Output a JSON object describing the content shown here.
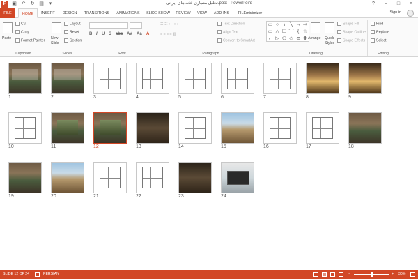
{
  "window": {
    "title": "تحلیل معماری خانه های ایرانی.pptx - PowerPoint",
    "app_logo": "P",
    "controls": [
      "?",
      "–",
      "□",
      "✕"
    ],
    "sign_in": "Sign in"
  },
  "quick_access": {
    "save_icon": "save-icon",
    "undo_icon": "undo-icon",
    "redo_icon": "redo-icon",
    "present_icon": "start-from-beginning-icon"
  },
  "tabs": [
    {
      "label": "FILE"
    },
    {
      "label": "HOME"
    },
    {
      "label": "INSERT"
    },
    {
      "label": "DESIGN"
    },
    {
      "label": "TRANSITIONS"
    },
    {
      "label": "ANIMATIONS"
    },
    {
      "label": "SLIDE SHOW"
    },
    {
      "label": "REVIEW"
    },
    {
      "label": "VIEW"
    },
    {
      "label": "ADD-INS"
    },
    {
      "label": "FILEminimizer"
    }
  ],
  "ribbon": {
    "clipboard": {
      "label": "Clipboard",
      "paste": "Paste",
      "cut": "Cut",
      "copy": "Copy",
      "format_painter": "Format Painter"
    },
    "slides": {
      "label": "Slides",
      "new_slide": "New",
      "new_slide_2": "Slide",
      "layout": "Layout",
      "reset": "Reset",
      "section": "Section"
    },
    "font": {
      "label": "Font",
      "bold": "B",
      "italic": "I",
      "underline": "U",
      "shadow": "S",
      "strike": "abc",
      "char_spacing": "AV",
      "case": "Aa",
      "font_color": "A"
    },
    "paragraph": {
      "label": "Paragraph",
      "text_direction": "Text Direction",
      "align_text": "Align Text",
      "convert_smartart": "Convert to SmartArt"
    },
    "drawing": {
      "label": "Drawing",
      "arrange": "Arrange",
      "quick_styles": "Quick",
      "quick_styles_2": "Styles",
      "shape_fill": "Shape Fill",
      "shape_outline": "Shape Outline",
      "shape_effects": "Shape Effects",
      "shapes": [
        "▭",
        "○",
        "\\",
        "╲",
        "→",
        "⇨",
        "▭",
        "△",
        "☐",
        "⌒",
        "{",
        "☆",
        "⌐",
        "▷",
        "⬠",
        "◇",
        "⊂",
        "✚"
      ]
    },
    "editing": {
      "label": "Editing",
      "find": "Find",
      "replace": "Replace",
      "select": "Select"
    }
  },
  "slides": [
    {
      "num": "1",
      "style": "courtyard",
      "overlay": true
    },
    {
      "num": "2",
      "style": "courtyard",
      "overlay": true
    },
    {
      "num": "3",
      "style": "plan"
    },
    {
      "num": "4",
      "style": "plan"
    },
    {
      "num": "5",
      "style": "plan"
    },
    {
      "num": "6",
      "style": "plan"
    },
    {
      "num": "7",
      "style": "plan"
    },
    {
      "num": "8",
      "style": "interior"
    },
    {
      "num": "9",
      "style": "interior"
    },
    {
      "num": "10",
      "style": "plan"
    },
    {
      "num": "11",
      "style": "courtyard",
      "overlay": true
    },
    {
      "num": "12",
      "style": "courtyard",
      "overlay": true,
      "selected": true
    },
    {
      "num": "13",
      "style": "dark"
    },
    {
      "num": "14",
      "style": "plan"
    },
    {
      "num": "15",
      "style": "sky"
    },
    {
      "num": "16",
      "style": "plan"
    },
    {
      "num": "17",
      "style": "plan"
    },
    {
      "num": "18",
      "style": "courtyard"
    },
    {
      "num": "19",
      "style": "courtyard"
    },
    {
      "num": "20",
      "style": "sky"
    },
    {
      "num": "21",
      "style": "plan"
    },
    {
      "num": "22",
      "style": "plan"
    },
    {
      "num": "23",
      "style": "dark"
    },
    {
      "num": "24",
      "style": "laptop"
    }
  ],
  "status": {
    "slide_info": "SLIDE 12 OF 24",
    "language": "PERSIAN",
    "zoom": "30%",
    "zoom_minus": "−",
    "zoom_plus": "+"
  },
  "colors": {
    "accent": "#d24726"
  }
}
